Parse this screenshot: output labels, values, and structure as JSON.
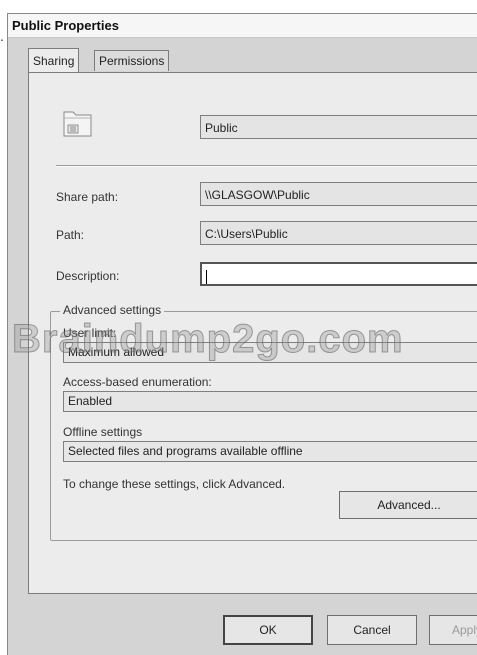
{
  "stray_mark": ".",
  "window": {
    "title": "Public Properties"
  },
  "tabs": [
    {
      "label": "Sharing",
      "active": true
    },
    {
      "label": "Permissions",
      "active": false
    }
  ],
  "share": {
    "folder_icon": "shared-folder-icon",
    "name_value": "Public",
    "share_path_label": "Share path:",
    "share_path_value": "\\\\GLASGOW\\Public",
    "path_label": "Path:",
    "path_value": "C:\\Users\\Public",
    "description_label": "Description:",
    "description_value": ""
  },
  "advanced": {
    "group_title": "Advanced settings",
    "user_limit_label": "User limit:",
    "user_limit_value": "Maximum allowed",
    "abe_label": "Access-based enumeration:",
    "abe_value": "Enabled",
    "offline_label": "Offline settings",
    "offline_value": "Selected files and programs available offline",
    "hint": "To change these settings, click Advanced.",
    "advanced_button": "Advanced..."
  },
  "watermark": "Braindump2go.com",
  "buttons": {
    "ok": "OK",
    "cancel": "Cancel",
    "apply": "Apply"
  }
}
